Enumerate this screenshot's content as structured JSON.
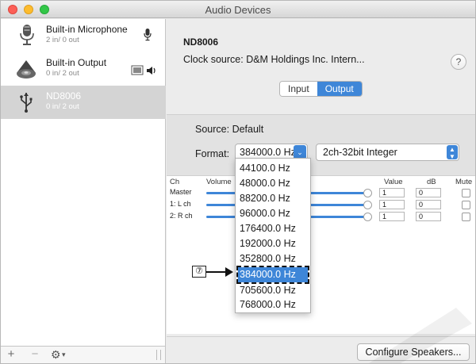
{
  "window": {
    "title": "Audio Devices"
  },
  "sidebar": {
    "devices": [
      {
        "name": "Built-in Microphone",
        "sub": "2 in/ 0 out",
        "icon": "microphone-icon"
      },
      {
        "name": "Built-in Output",
        "sub": "0 in/ 2 out",
        "icon": "speaker-icon"
      },
      {
        "name": "ND8006",
        "sub": "0 in/ 2 out",
        "icon": "usb-icon",
        "selected": true
      }
    ],
    "bottom": {
      "add": "+",
      "remove": "−",
      "gear": "⚙",
      "chev": "▾"
    }
  },
  "main": {
    "device_title": "ND8006",
    "clock_source": "Clock source: D&M Holdings Inc. Intern...",
    "help": "?",
    "tabs": [
      {
        "label": "Input",
        "active": false
      },
      {
        "label": "Output",
        "active": true
      }
    ],
    "source_label": "Source:",
    "source_value": "Default",
    "format_label": "Format:",
    "format_value": "384000.0 Hz",
    "format_bits": "2ch-32bit Integer",
    "table": {
      "headers": {
        "ch": "Ch",
        "volume": "Volume",
        "value": "Value",
        "db": "dB",
        "mute": "Mute"
      },
      "rows": [
        {
          "ch": "Master",
          "value": "1",
          "db": "0"
        },
        {
          "ch": "1: L ch",
          "value": "1",
          "db": "0"
        },
        {
          "ch": "2: R ch",
          "value": "1",
          "db": "0"
        }
      ]
    },
    "configure_button": "Configure Speakers..."
  },
  "dropdown": {
    "items": [
      "44100.0 Hz",
      "48000.0 Hz",
      "88200.0 Hz",
      "96000.0 Hz",
      "176400.0 Hz",
      "192000.0 Hz",
      "352800.0 Hz",
      "384000.0 Hz",
      "705600.0 Hz",
      "768000.0 Hz"
    ],
    "selected_index": 7
  },
  "callout": {
    "number": "⑦"
  },
  "colors": {
    "accent": "#3e86d8",
    "selection_bg": "#d4d4d4"
  }
}
